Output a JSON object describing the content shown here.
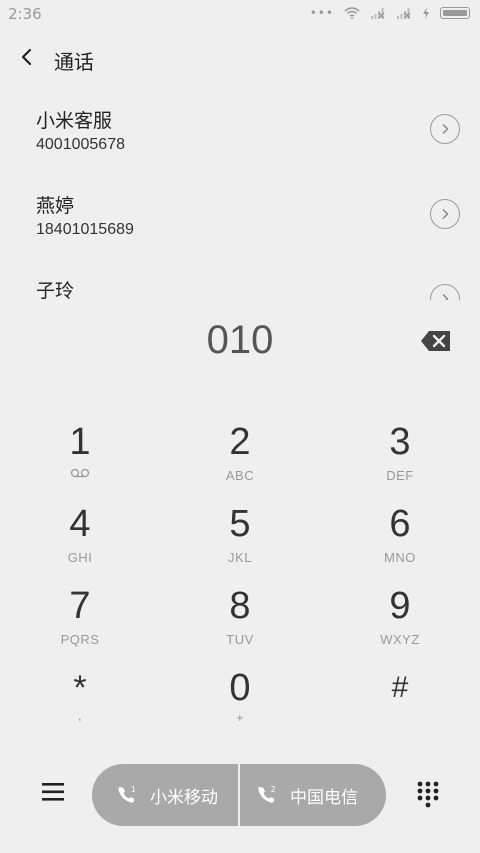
{
  "status": {
    "time": "2:36"
  },
  "header": {
    "title": "通话"
  },
  "contacts": [
    {
      "name": "小米客服",
      "number": "4001005678"
    },
    {
      "name": "燕婷",
      "number": "18401015689"
    },
    {
      "name": "子玲",
      "number": ""
    }
  ],
  "dialer": {
    "typed_number": "010",
    "keys": [
      {
        "digit": "1",
        "letters": ""
      },
      {
        "digit": "2",
        "letters": "ABC"
      },
      {
        "digit": "3",
        "letters": "DEF"
      },
      {
        "digit": "4",
        "letters": "GHI"
      },
      {
        "digit": "5",
        "letters": "JKL"
      },
      {
        "digit": "6",
        "letters": "MNO"
      },
      {
        "digit": "7",
        "letters": "PQRS"
      },
      {
        "digit": "8",
        "letters": "TUV"
      },
      {
        "digit": "9",
        "letters": "WXYZ"
      },
      {
        "digit": "*",
        "letters": ","
      },
      {
        "digit": "0",
        "letters": "+"
      },
      {
        "digit": "#",
        "letters": ""
      }
    ]
  },
  "bottom": {
    "sim1_label": "小米移动",
    "sim1_index": "1",
    "sim2_label": "中国电信",
    "sim2_index": "2"
  }
}
